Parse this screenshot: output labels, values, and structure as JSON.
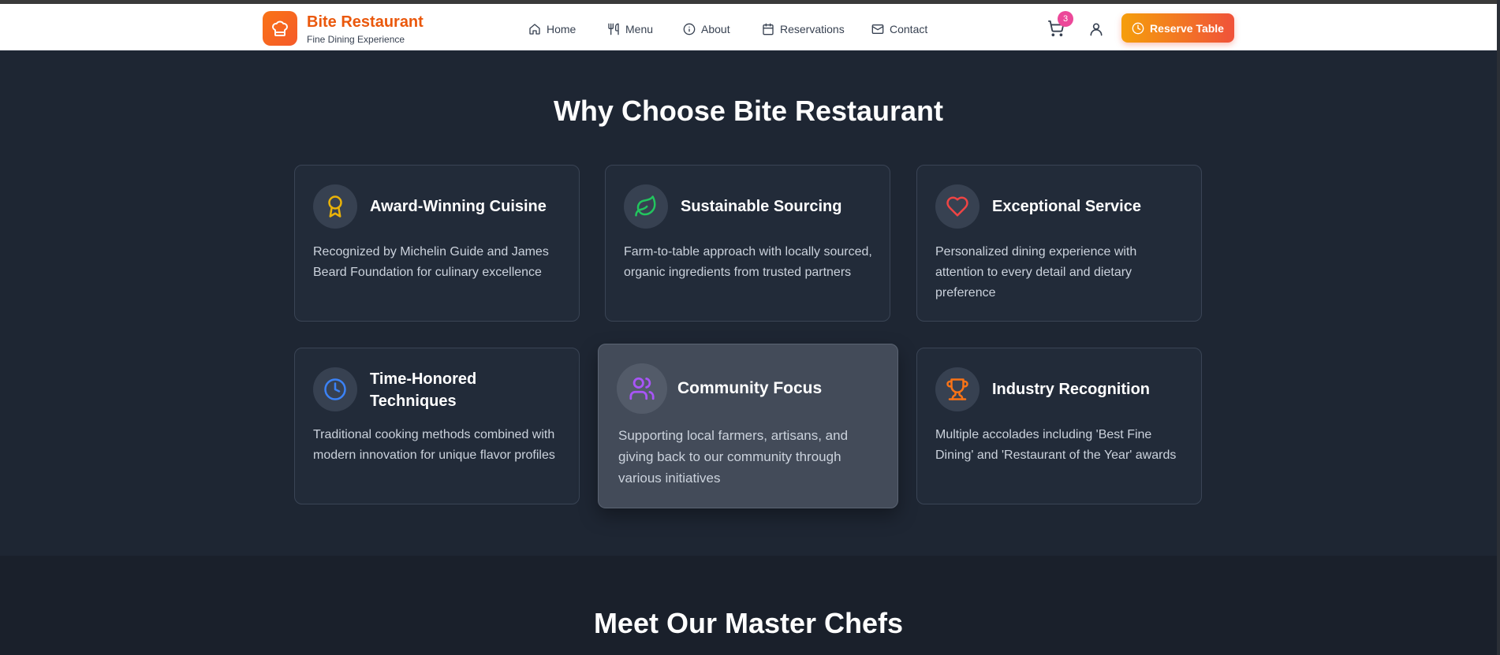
{
  "header": {
    "brand_name": "Bite Restaurant",
    "brand_tagline": "Fine Dining Experience",
    "nav": [
      {
        "label": "Home",
        "icon": "home-icon"
      },
      {
        "label": "Menu",
        "icon": "utensils-icon"
      },
      {
        "label": "About",
        "icon": "info-icon"
      },
      {
        "label": "Reservations",
        "icon": "calendar-icon"
      },
      {
        "label": "Contact",
        "icon": "mail-icon"
      }
    ],
    "cart_count": "3",
    "reserve_label": "Reserve Table"
  },
  "why": {
    "title": "Why Choose Bite Restaurant",
    "features": [
      {
        "title": "Award-Winning Cuisine",
        "description": "Recognized by Michelin Guide and James Beard Foundation for culinary excellence",
        "icon": "award-icon",
        "icon_color": "#eab308"
      },
      {
        "title": "Sustainable Sourcing",
        "description": "Farm-to-table approach with locally sourced, organic ingredients from trusted partners",
        "icon": "leaf-icon",
        "icon_color": "#22c55e"
      },
      {
        "title": "Exceptional Service",
        "description": "Personalized dining experience with attention to every detail and dietary preference",
        "icon": "heart-icon",
        "icon_color": "#ef4444"
      },
      {
        "title": "Time-Honored Techniques",
        "description": "Traditional cooking methods combined with modern innovation for unique flavor profiles",
        "icon": "clock-icon",
        "icon_color": "#3b82f6"
      },
      {
        "title": "Community Focus",
        "description": "Supporting local farmers, artisans, and giving back to our community through various initiatives",
        "icon": "users-icon",
        "icon_color": "#a855f7"
      },
      {
        "title": "Industry Recognition",
        "description": "Multiple accolades including 'Best Fine Dining' and 'Restaurant of the Year' awards",
        "icon": "trophy-icon",
        "icon_color": "#f97316"
      }
    ]
  },
  "chefs": {
    "title": "Meet Our Master Chefs"
  },
  "colors": {
    "brand": "#ea580c",
    "badge": "#ec4899",
    "section_bg": "#1e2633"
  }
}
